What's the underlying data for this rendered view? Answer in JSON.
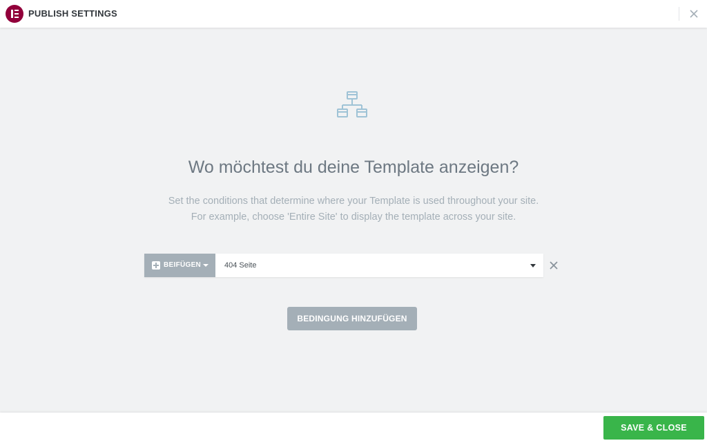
{
  "header": {
    "title": "PUBLISH SETTINGS",
    "logo_icon": "elementor-logo-icon",
    "close_icon": "close-icon"
  },
  "main": {
    "icon": "sitemap-icon",
    "heading": "Wo möchtest du deine Template anzeigen?",
    "description_line1": "Set the conditions that determine where your Template is used throughout your site.",
    "description_line2": "For example, choose 'Entire Site' to display the template across your site.",
    "condition": {
      "include_label": "BEIFÜGEN",
      "include_icon": "plus-square-icon",
      "value": "404 Seite",
      "remove_icon": "close-icon"
    },
    "add_condition_label": "BEDINGUNG HINZUFÜGEN"
  },
  "footer": {
    "save_label": "SAVE & CLOSE"
  },
  "colors": {
    "brand": "#92003b",
    "save": "#39b54a",
    "neutral_button": "#a4afb7",
    "background": "#f1f2f3"
  }
}
